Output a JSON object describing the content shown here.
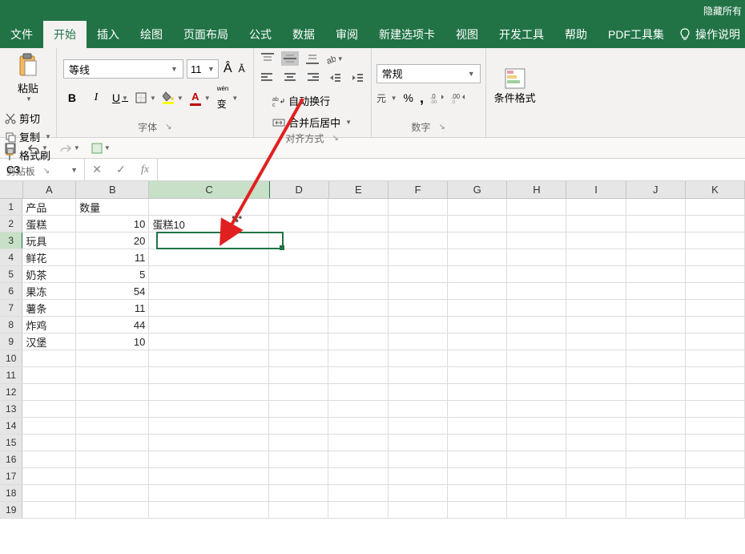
{
  "title_right": "隐藏所有",
  "tabs": {
    "file": "文件",
    "home": "开始",
    "insert": "插入",
    "draw": "绘图",
    "layout": "页面布局",
    "formula": "公式",
    "data": "数据",
    "review": "审阅",
    "newtab": "新建选项卡",
    "view": "视图",
    "dev": "开发工具",
    "help": "帮助",
    "pdf": "PDF工具集"
  },
  "operate_hint": "操作说明",
  "clipboard": {
    "paste": "粘贴",
    "cut": "剪切",
    "copy": "复制",
    "format_painter": "格式刷",
    "group": "剪贴板"
  },
  "font": {
    "name": "等线",
    "size": "11",
    "bold": "B",
    "italic": "I",
    "underline": "U",
    "group": "字体"
  },
  "alignment": {
    "wrap": "自动换行",
    "merge": "合并后居中",
    "group": "对齐方式"
  },
  "number": {
    "general": "常规",
    "percent": "%",
    "comma": ",",
    "group": "数字"
  },
  "styles": {
    "cond_format": "条件格式"
  },
  "name_box": "C3",
  "formula_value": "",
  "columns": [
    "A",
    "B",
    "C",
    "D",
    "E",
    "F",
    "G",
    "H",
    "I",
    "J",
    "K"
  ],
  "rows": [
    1,
    2,
    3,
    4,
    5,
    6,
    7,
    8,
    9,
    10,
    11,
    12,
    13,
    14,
    15,
    16,
    17,
    18,
    19
  ],
  "cells": {
    "header_product": "产品",
    "header_qty": "数量",
    "data": [
      {
        "product": "蛋糕",
        "qty": 10,
        "c": "蛋糕10"
      },
      {
        "product": "玩具",
        "qty": 20,
        "c": ""
      },
      {
        "product": "鲜花",
        "qty": 11,
        "c": ""
      },
      {
        "product": "奶茶",
        "qty": 5,
        "c": ""
      },
      {
        "product": "果冻",
        "qty": 54,
        "c": ""
      },
      {
        "product": "薯条",
        "qty": 11,
        "c": ""
      },
      {
        "product": "炸鸡",
        "qty": 44,
        "c": ""
      },
      {
        "product": "汉堡",
        "qty": 10,
        "c": ""
      }
    ]
  },
  "active_cell": {
    "row": 3,
    "col": "C"
  }
}
